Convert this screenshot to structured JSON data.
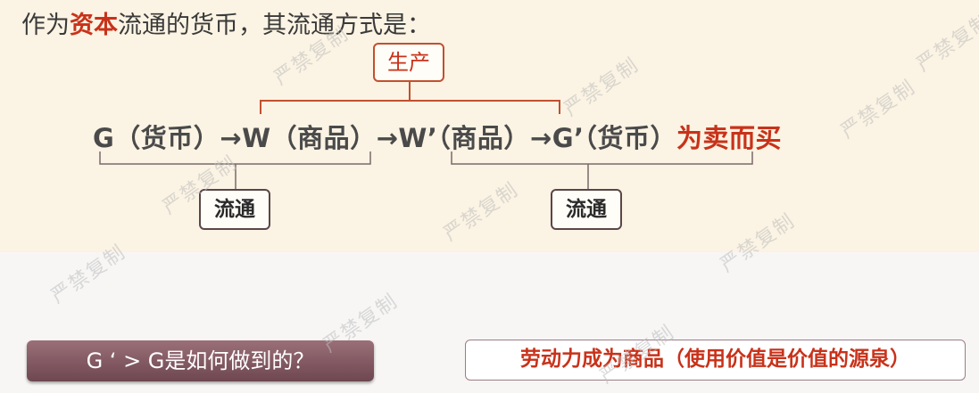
{
  "heading": {
    "prefix": "作为",
    "highlight": "资本",
    "suffix": "流通的货币，其流通方式是："
  },
  "formula": {
    "main": "G（货币）→W（商品）→W’（商品）→G’（货币）",
    "tail": "为卖而买"
  },
  "labels": {
    "production": "生产",
    "circulation_1": "流通",
    "circulation_2": "流通"
  },
  "question_button": "G ‘ > G是如何做到的？",
  "answer": "劳动力成为商品（使用价值是价值的源泉）",
  "watermark": "严禁复制",
  "colors": {
    "accent": "#c8321a",
    "top_panel_bg": "#fbf3e3",
    "button_bg": "#7a5560"
  }
}
